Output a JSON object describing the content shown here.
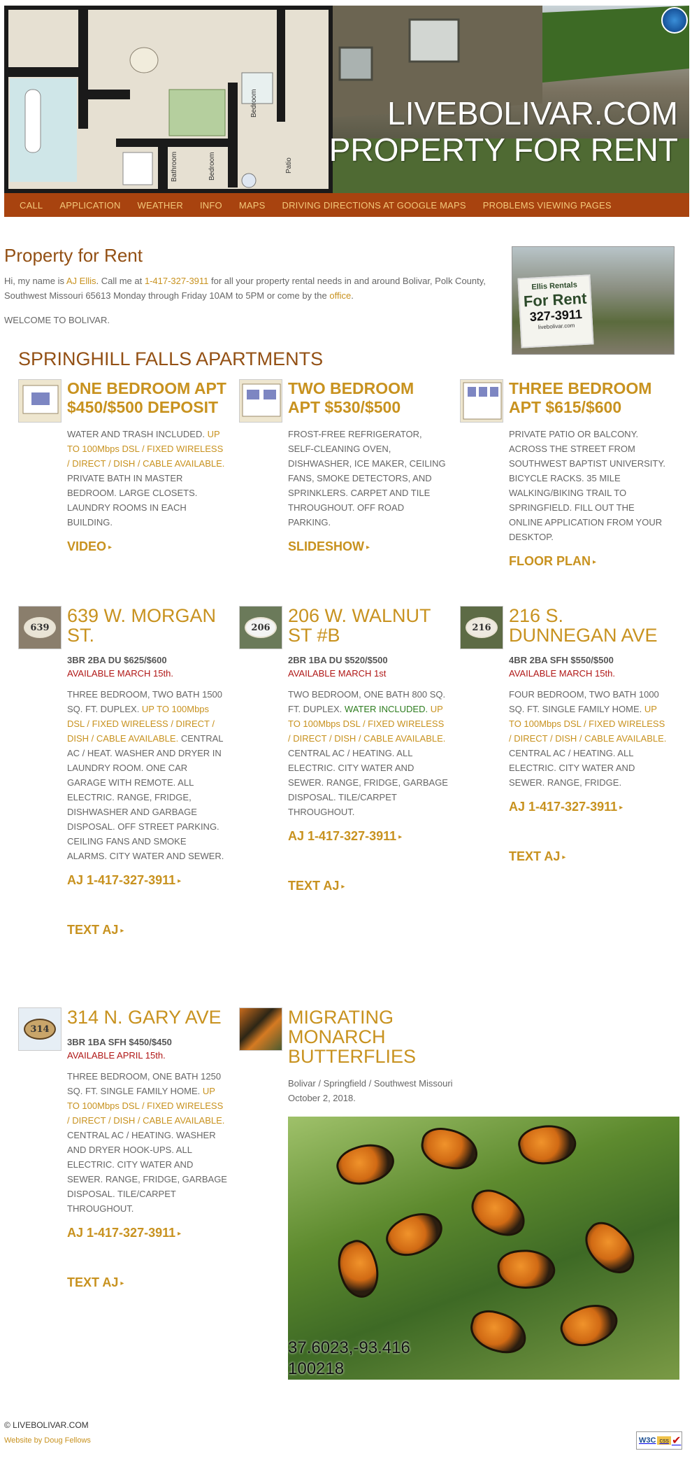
{
  "header": {
    "title_line1": "LIVEBOLIVAR.COM",
    "title_line2": "PROPERTY FOR RENT"
  },
  "nav": {
    "items": [
      {
        "label": "CALL"
      },
      {
        "label": "APPLICATION"
      },
      {
        "label": "WEATHER"
      },
      {
        "label": "INFO"
      },
      {
        "label": "MAPS"
      },
      {
        "label": "DRIVING DIRECTIONS AT GOOGLE MAPS"
      },
      {
        "label": "PROBLEMS VIEWING PAGES"
      }
    ]
  },
  "intro": {
    "title": "Property for Rent",
    "text_a": "Hi, my name is ",
    "name_link": "AJ Ellis",
    "text_b": ".  Call me at ",
    "phone_link": "1-417-327-3911",
    "text_c": " for all your property rental needs in and around Bolivar, Polk County, Southwest Missouri 65613 Monday through Friday 10AM to 5PM or come by the ",
    "office_link": "office",
    "text_d": ".",
    "welcome": "WELCOME TO BOLIVAR."
  },
  "sign": {
    "line1": "Ellis Rentals",
    "line2": "For Rent",
    "line3": "327-3911",
    "line4": "livebolivar.com"
  },
  "complex_title": "SPRINGHILL FALLS APARTMENTS",
  "apartments": [
    {
      "title": "ONE BEDROOM APT $450/$500 DEPOSIT",
      "desc_a": "WATER AND TRASH INCLUDED. ",
      "desc_hl": "UP TO 100Mbps DSL / FIXED WIRELESS / DIRECT / DISH / CABLE AVAILABLE.",
      "desc_b": "  PRIVATE BATH IN MASTER BEDROOM.  LARGE CLOSETS.  LAUNDRY ROOMS IN EACH BUILDING.",
      "link": "VIDEO"
    },
    {
      "title": "TWO BEDROOM APT $530/$500",
      "desc": "FROST-FREE REFRIGERATOR, SELF-CLEANING OVEN, DISHWASHER, ICE MAKER, CEILING FANS, SMOKE DETECTORS, AND SPRINKLERS.  CARPET AND TILE THROUGHOUT.  OFF ROAD PARKING.",
      "link": "SLIDESHOW"
    },
    {
      "title": "THREE BEDROOM APT $615/$600",
      "desc": "PRIVATE PATIO OR BALCONY.  ACROSS THE STREET FROM SOUTHWEST BAPTIST UNIVERSITY.  BICYCLE RACKS.  35 MILE WALKING/BIKING TRAIL TO SPRINGFIELD.  FILL OUT THE ONLINE APPLICATION FROM YOUR DESKTOP.",
      "link": "FLOOR PLAN"
    }
  ],
  "properties": [
    {
      "plaque": "639",
      "title": "639 W. MORGAN ST.",
      "sub": "3BR 2BA DU $625/$600",
      "avail": "AVAILABLE MARCH 15th.",
      "desc_a": "THREE BEDROOM, TWO BATH 1500 SQ. FT. DUPLEX.  ",
      "desc_hl": "UP TO 100Mbps DSL / FIXED WIRELESS / DIRECT / DISH / CABLE AVAILABLE.",
      "desc_b": "  CENTRAL AC / HEAT. WASHER AND DRYER IN LAUNDRY ROOM.  ONE CAR GARAGE WITH REMOTE.  ALL ELECTRIC. RANGE, FRIDGE, DISHWASHER AND GARBAGE DISPOSAL. OFF STREET PARKING.  CEILING FANS AND SMOKE ALARMS.  CITY WATER AND SEWER.",
      "call": "AJ 1-417-327-3911",
      "text": "TEXT AJ"
    },
    {
      "plaque": "206",
      "title": "206 W. WALNUT ST #B",
      "sub": "2BR 1BA DU $520/$500",
      "avail": "AVAILABLE MARCH 1st",
      "desc_a": "TWO BEDROOM, ONE BATH 800 SQ. FT. DUPLEX. ",
      "desc_gr": "WATER INCLUDED.",
      "desc_hl": "  UP TO 100Mbps DSL / FIXED WIRELESS / DIRECT / DISH / CABLE AVAILABLE.",
      "desc_b": " CENTRAL AC / HEATING. ALL ELECTRIC. CITY WATER AND SEWER. RANGE, FRIDGE, GARBAGE DISPOSAL. TILE/CARPET THROUGHOUT.",
      "call": "AJ 1-417-327-3911",
      "text": "TEXT AJ"
    },
    {
      "plaque": "216",
      "title": "216 S. DUNNEGAN AVE",
      "sub": "4BR 2BA SFH $550/$500",
      "avail": "AVAILABLE MARCH 15th.",
      "desc_a": "FOUR BEDROOM, TWO BATH 1000 SQ. FT. SINGLE FAMILY HOME.  ",
      "desc_hl": "UP TO 100Mbps DSL / FIXED WIRELESS / DIRECT / DISH / CABLE AVAILABLE.",
      "desc_b": " CENTRAL AC / HEATING. ALL ELECTRIC. CITY WATER AND SEWER. RANGE, FRIDGE.",
      "call": "AJ 1-417-327-3911",
      "text": "TEXT AJ"
    },
    {
      "plaque": "314",
      "title": "314 N. GARY AVE",
      "sub": "3BR 1BA SFH $450/$450",
      "avail": "AVAILABLE APRIL 15th.",
      "desc_a": "THREE BEDROOM, ONE BATH 1250 SQ. FT. SINGLE FAMILY HOME.  ",
      "desc_hl": "UP TO 100Mbps DSL / FIXED WIRELESS / DIRECT / DISH / CABLE AVAILABLE.",
      "desc_b": " CENTRAL AC / HEATING. WASHER AND DRYER HOOK-UPS. ALL ELECTRIC. CITY WATER AND SEWER. RANGE, FRIDGE, GARBAGE DISPOSAL. TILE/CARPET THROUGHOUT.",
      "call": "AJ 1-417-327-3911",
      "text": "TEXT AJ"
    }
  ],
  "butterflies": {
    "title": "MIGRATING MONARCH BUTTERFLIES",
    "caption": "Bolivar / Springfield / Southwest Missouri October 2, 2018.",
    "coords_line1": "37.6023,-93.416",
    "coords_line2": "100218"
  },
  "footer": {
    "copyright": "© LIVEBOLIVAR.COM",
    "credit": "Website by Doug Fellows",
    "badge_w3c": "W3C",
    "badge_css": "css",
    "badge_check": "✔"
  },
  "colors": {
    "nav_bg": "#a8430f",
    "nav_text": "#f3c87a",
    "accent_gold": "#c8921f",
    "title_brown": "#935014",
    "available_red": "#b01817"
  }
}
